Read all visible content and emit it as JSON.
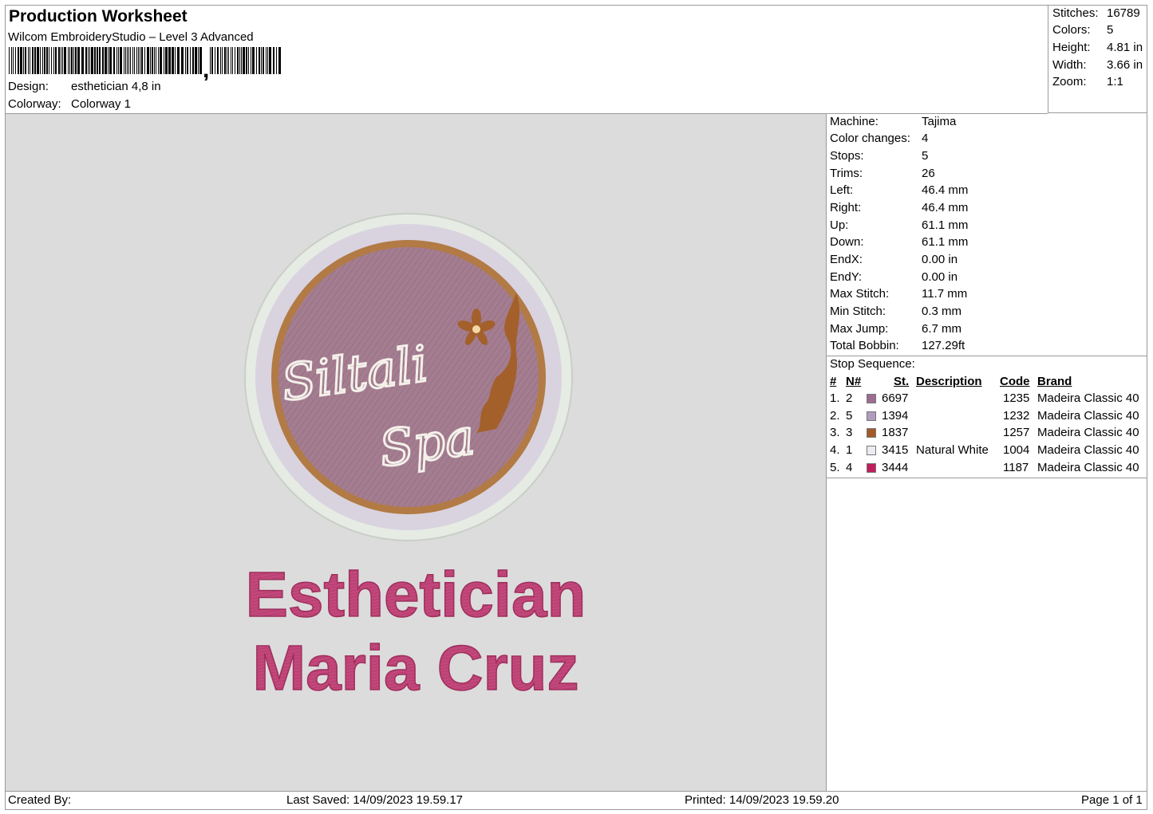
{
  "header": {
    "title": "Production Worksheet",
    "subtitle": "Wilcom EmbroideryStudio – Level 3 Advanced",
    "design_label": "Design:",
    "design_value": "esthetician 4,8 in",
    "colorway_label": "Colorway:",
    "colorway_value": "Colorway 1"
  },
  "summary": {
    "stitches_label": "Stitches:",
    "stitches_value": "16789",
    "colors_label": "Colors:",
    "colors_value": "5",
    "height_label": "Height:",
    "height_value": "4.81 in",
    "width_label": "Width:",
    "width_value": "3.66 in",
    "zoom_label": "Zoom:",
    "zoom_value": "1:1"
  },
  "design": {
    "logo_script_line1": "Siltali",
    "logo_script_line2": "Spa",
    "text_line1": "Esthetician",
    "text_line2": "Maria Cruz",
    "colors": {
      "outer_ring": "#d9d3df",
      "outer_border": "#e6ece4",
      "inner_fill": "#a47d90",
      "inner_border": "#b27a45",
      "script": "#f4f1ea",
      "flower": "#a4602a",
      "text": "#c2477a"
    }
  },
  "machine": {
    "machine_label": "Machine:",
    "machine_value": "Tajima",
    "color_changes_label": "Color changes:",
    "color_changes_value": "4",
    "stops_label": "Stops:",
    "stops_value": "5",
    "trims_label": "Trims:",
    "trims_value": "26",
    "left_label": "Left:",
    "left_value": "46.4 mm",
    "right_label": "Right:",
    "right_value": "46.4 mm",
    "up_label": "Up:",
    "up_value": "61.1 mm",
    "down_label": "Down:",
    "down_value": "61.1 mm",
    "endx_label": "EndX:",
    "endx_value": "0.00 in",
    "endy_label": "EndY:",
    "endy_value": "0.00 in",
    "max_stitch_label": "Max Stitch:",
    "max_stitch_value": "11.7 mm",
    "min_stitch_label": "Min Stitch:",
    "min_stitch_value": "0.3 mm",
    "max_jump_label": "Max Jump:",
    "max_jump_value": "6.7 mm",
    "total_bobbin_label": "Total Bobbin:",
    "total_bobbin_value": "127.29ft"
  },
  "stop_sequence": {
    "title": "Stop Sequence:",
    "headers": {
      "num": "#",
      "n": "N#",
      "st": "St.",
      "description": "Description",
      "code": "Code",
      "brand": "Brand"
    },
    "rows": [
      {
        "num": "1.",
        "n": "2",
        "color": "#9c6c91",
        "st": "6697",
        "description": "",
        "code": "1235",
        "brand": "Madeira Classic 40"
      },
      {
        "num": "2.",
        "n": "5",
        "color": "#b09cbd",
        "st": "1394",
        "description": "",
        "code": "1232",
        "brand": "Madeira Classic 40"
      },
      {
        "num": "3.",
        "n": "3",
        "color": "#a35a2a",
        "st": "1837",
        "description": "",
        "code": "1257",
        "brand": "Madeira Classic 40"
      },
      {
        "num": "4.",
        "n": "1",
        "color": "#ececf0",
        "st": "3415",
        "description": "Natural White",
        "code": "1004",
        "brand": "Madeira Classic 40"
      },
      {
        "num": "5.",
        "n": "4",
        "color": "#c21d5c",
        "st": "3444",
        "description": "",
        "code": "1187",
        "brand": "Madeira Classic 40"
      }
    ]
  },
  "footer": {
    "created_by": "Created By:",
    "last_saved": "Last Saved: 14/09/2023 19.59.17",
    "printed": "Printed: 14/09/2023 19.59.20",
    "page": "Page 1 of 1"
  }
}
